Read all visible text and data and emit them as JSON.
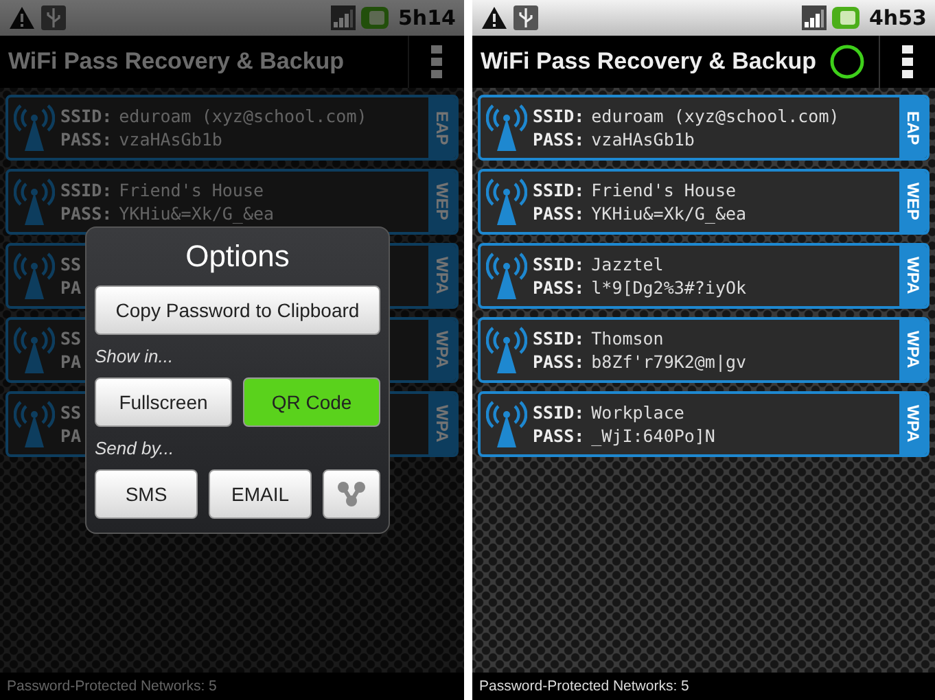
{
  "screens": [
    {
      "status_bar": {
        "time": "5h14"
      },
      "title": "WiFi Pass Recovery & Backup",
      "loading": false,
      "dimmed": true,
      "networks": [
        {
          "ssid_label": "SSID:",
          "ssid": "eduroam (xyz@school.com)",
          "pass_label": "PASS:",
          "pass": "vzaHAsGb1b",
          "security": "EAP"
        },
        {
          "ssid_label": "SSID:",
          "ssid": "Friend's House",
          "pass_label": "PASS:",
          "pass": "YKHiu&=Xk/G_&ea",
          "security": "WEP"
        },
        {
          "ssid_label": "SS",
          "pass_label": "PA",
          "security": "WPA"
        },
        {
          "ssid_label": "SS",
          "pass_label": "PA",
          "security": "WPA"
        },
        {
          "ssid_label": "SS",
          "pass_label": "PA",
          "security": "WPA"
        }
      ],
      "footer": "Password-Protected Networks: 5",
      "dialog": {
        "title": "Options",
        "copy_button": "Copy Password to Clipboard",
        "show_label": "Show in...",
        "show_buttons": [
          {
            "label": "Fullscreen",
            "selected": false
          },
          {
            "label": "QR Code",
            "selected": true
          }
        ],
        "send_label": "Send by...",
        "send_buttons": [
          {
            "kind": "text",
            "label": "SMS"
          },
          {
            "kind": "text",
            "label": "EMAIL"
          },
          {
            "kind": "icon"
          }
        ]
      }
    },
    {
      "status_bar": {
        "time": "4h53"
      },
      "title": "WiFi Pass Recovery & Backup",
      "loading": true,
      "dimmed": false,
      "networks": [
        {
          "ssid_label": "SSID:",
          "ssid": "eduroam (xyz@school.com)",
          "pass_label": "PASS:",
          "pass": "vzaHAsGb1b",
          "security": "EAP"
        },
        {
          "ssid_label": "SSID:",
          "ssid": "Friend's House",
          "pass_label": "PASS:",
          "pass": "YKHiu&=Xk/G_&ea",
          "security": "WEP"
        },
        {
          "ssid_label": "SSID:",
          "ssid": "Jazztel",
          "pass_label": "PASS:",
          "pass": "l*9[Dg2%3#?iyOk",
          "security": "WPA"
        },
        {
          "ssid_label": "SSID:",
          "ssid": "Thomson",
          "pass_label": "PASS:",
          "pass": "b8Zf'r79K2@m|gv",
          "security": "WPA"
        },
        {
          "ssid_label": "SSID:",
          "ssid": "Workplace",
          "pass_label": "PASS:",
          "pass": "_WjI:640Po]N",
          "security": "WPA"
        }
      ],
      "footer": "Password-Protected Networks: 5"
    }
  ]
}
